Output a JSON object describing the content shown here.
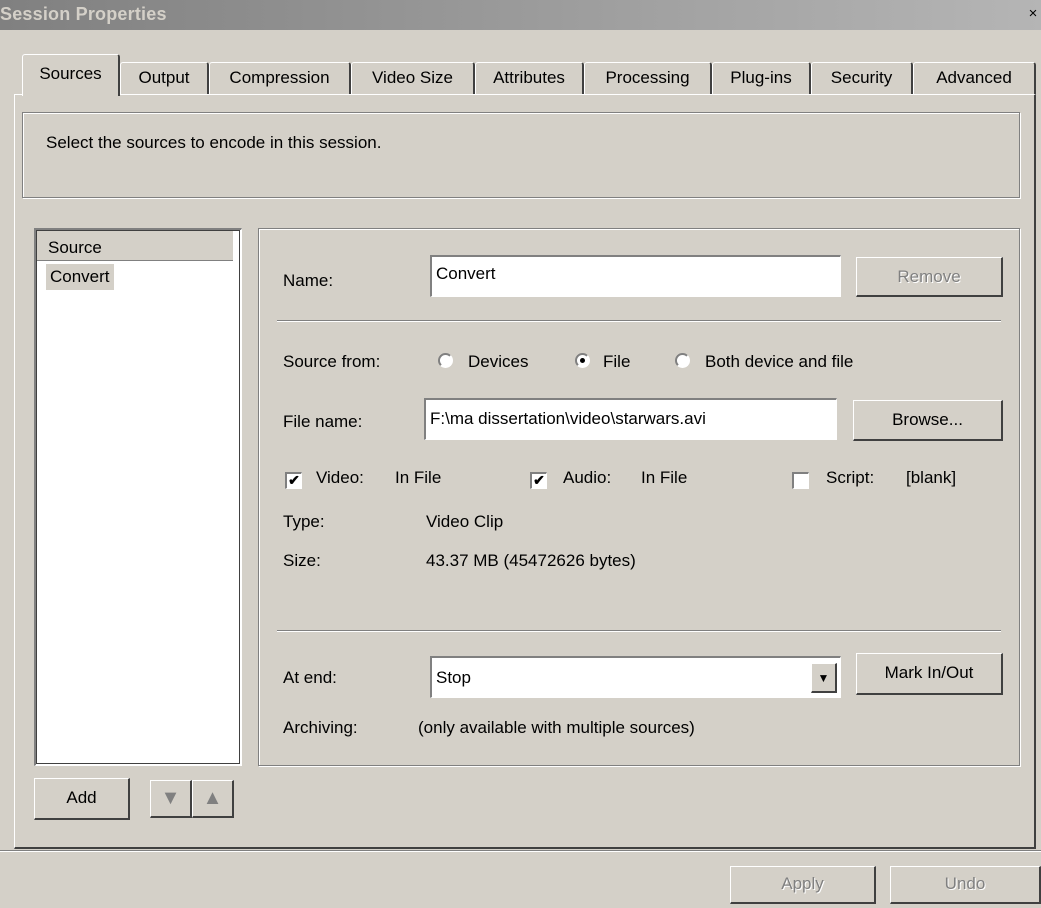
{
  "window": {
    "title": "Session Properties",
    "close_glyph": "×"
  },
  "tabs": [
    {
      "label": "Sources",
      "active": true
    },
    {
      "label": "Output"
    },
    {
      "label": "Compression"
    },
    {
      "label": "Video Size"
    },
    {
      "label": "Attributes"
    },
    {
      "label": "Processing"
    },
    {
      "label": "Plug-ins"
    },
    {
      "label": "Security"
    },
    {
      "label": "Advanced"
    }
  ],
  "info": {
    "text": "Select the sources to encode in this session."
  },
  "source_list": {
    "header": "Source",
    "items": [
      "Convert"
    ]
  },
  "properties": {
    "name_label": "Name:",
    "name_value": "Convert",
    "remove_button": "Remove",
    "source_from_label": "Source from:",
    "source_options": [
      "Devices",
      "File",
      "Both device and file"
    ],
    "source_selected": "File",
    "file_name_label": "File name:",
    "file_name_value": "F:\\ma dissertation\\video\\starwars.avi",
    "browse_button": "Browse...",
    "video_label": "Video:",
    "video_value": "In File",
    "video_checked": true,
    "audio_label": "Audio:",
    "audio_value": "In File",
    "audio_checked": true,
    "script_label": "Script:",
    "script_value": "[blank]",
    "script_checked": false,
    "type_label": "Type:",
    "type_value": "Video Clip",
    "size_label": "Size:",
    "size_value": "43.37 MB (45472626 bytes)",
    "at_end_label": "At end:",
    "at_end_value": "Stop",
    "mark_button": "Mark In/Out",
    "archiving_label": "Archiving:",
    "archiving_value": "(only available with multiple sources)"
  },
  "list_controls": {
    "add_button": "Add",
    "down_glyph": "▼",
    "up_glyph": "▲"
  },
  "footer": {
    "apply_button": "Apply",
    "undo_button": "Undo"
  },
  "icons": {
    "checkmark": "✔",
    "dropdown": "▼"
  }
}
